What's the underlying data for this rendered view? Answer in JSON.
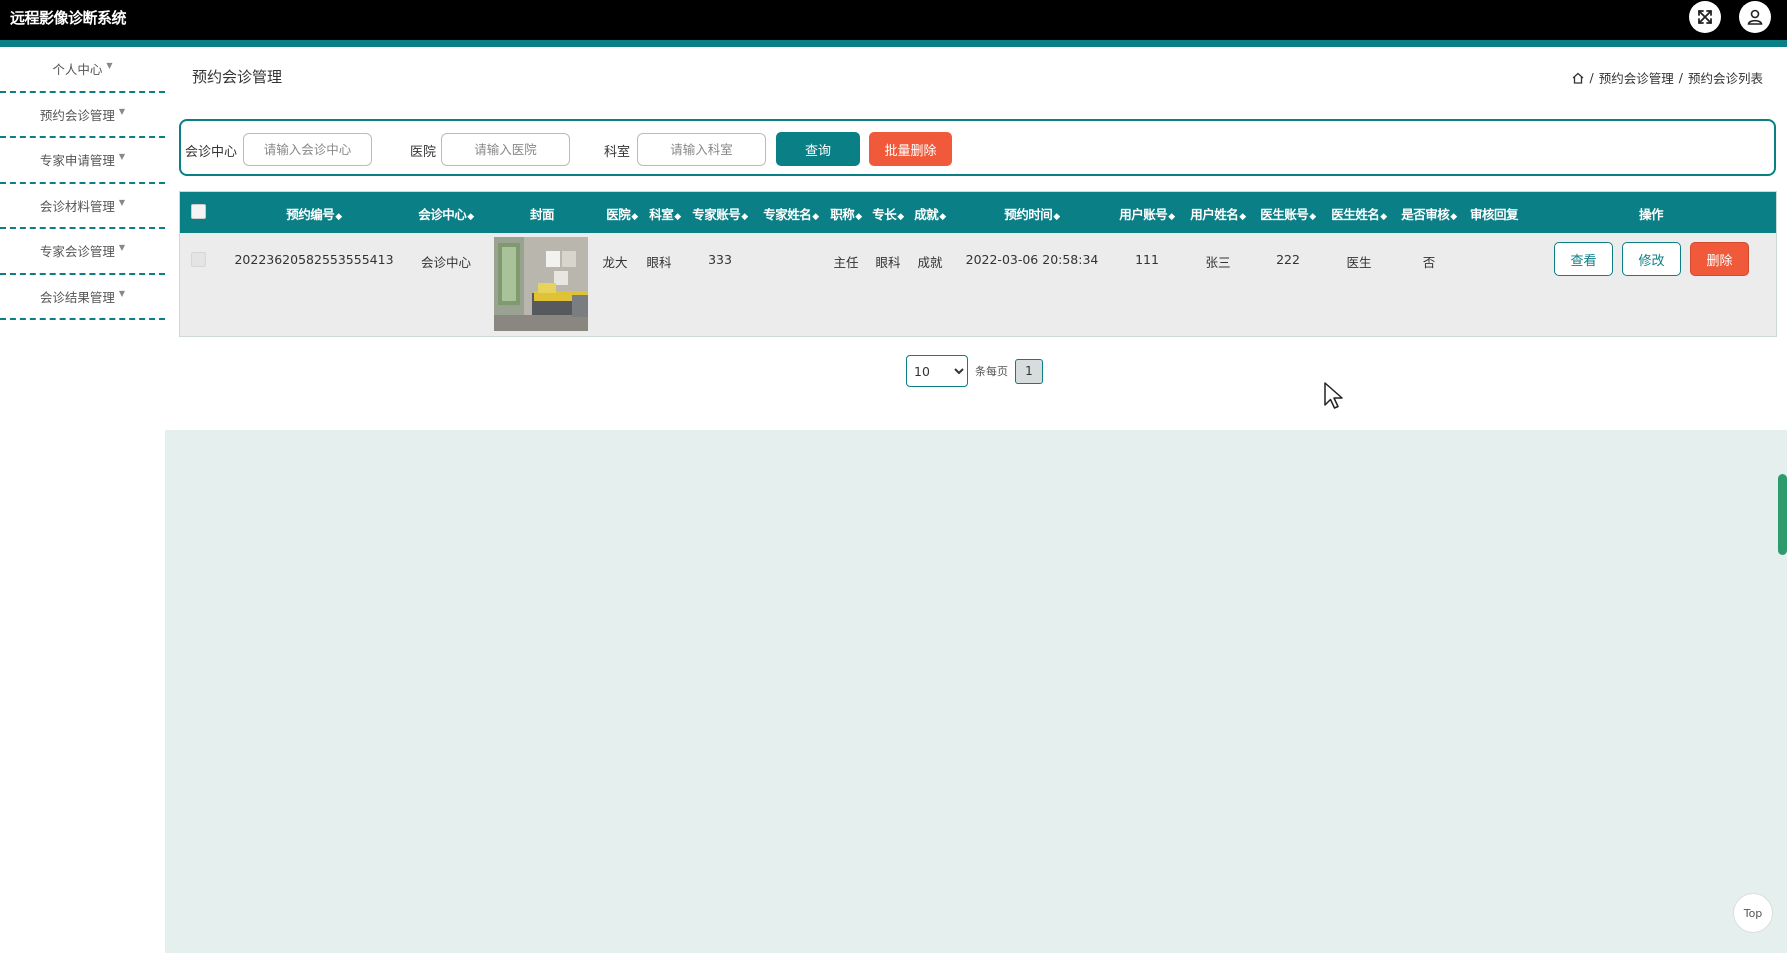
{
  "app": {
    "title": "远程影像诊断系统"
  },
  "header": {
    "fullscreen_icon": "fullscreen-icon",
    "user_icon": "user-icon"
  },
  "sidebar": {
    "items": [
      {
        "label": "个人中心"
      },
      {
        "label": "预约会诊管理"
      },
      {
        "label": "专家申请管理"
      },
      {
        "label": "会诊材料管理"
      },
      {
        "label": "专家会诊管理"
      },
      {
        "label": "会诊结果管理"
      }
    ]
  },
  "page": {
    "title": "预约会诊管理"
  },
  "breadcrumb": {
    "items": [
      "预约会诊管理",
      "预约会诊列表"
    ],
    "separator": "/"
  },
  "search": {
    "center_label": "会诊中心",
    "center_placeholder": "请输入会诊中心",
    "hospital_label": "医院",
    "hospital_placeholder": "请输入医院",
    "dept_label": "科室",
    "dept_placeholder": "请输入科室",
    "query_label": "查询",
    "batch_delete_label": "批量删除"
  },
  "table": {
    "headers": {
      "booking_no": "预约编号",
      "center": "会诊中心",
      "cover": "封面",
      "hospital": "医院",
      "dept": "科室",
      "expert_account": "专家账号",
      "expert_name": "专家姓名",
      "title": "职称",
      "specialty": "专长",
      "achievement": "成就",
      "booking_time": "预约时间",
      "user_account": "用户账号",
      "user_name": "用户姓名",
      "doctor_account": "医生账号",
      "doctor_name": "医生姓名",
      "reviewed": "是否审核",
      "review_reply": "审核回复",
      "actions": "操作"
    },
    "rows": [
      {
        "booking_no": "20223620582553555413",
        "center": "会诊中心",
        "hospital": "龙大",
        "dept": "眼科",
        "expert_account": "333",
        "expert_name": "",
        "title": "主任",
        "specialty": "眼科",
        "achievement": "成就",
        "booking_time": "2022-03-06 20:58:34",
        "user_account": "111",
        "user_name": "张三",
        "doctor_account": "222",
        "doctor_name": "医生",
        "reviewed": "否",
        "review_reply": ""
      }
    ],
    "row_actions": {
      "view": "查看",
      "edit": "修改",
      "delete": "删除"
    }
  },
  "pagination": {
    "page_size": "10",
    "per_page_label": "条每页",
    "current_page": "1"
  },
  "scroll_top": {
    "label": "Top"
  },
  "colors": {
    "accent": "#0b7f86",
    "danger": "#f05a3a",
    "lower_bg": "#e5f0ee",
    "topbar": "#000000"
  }
}
